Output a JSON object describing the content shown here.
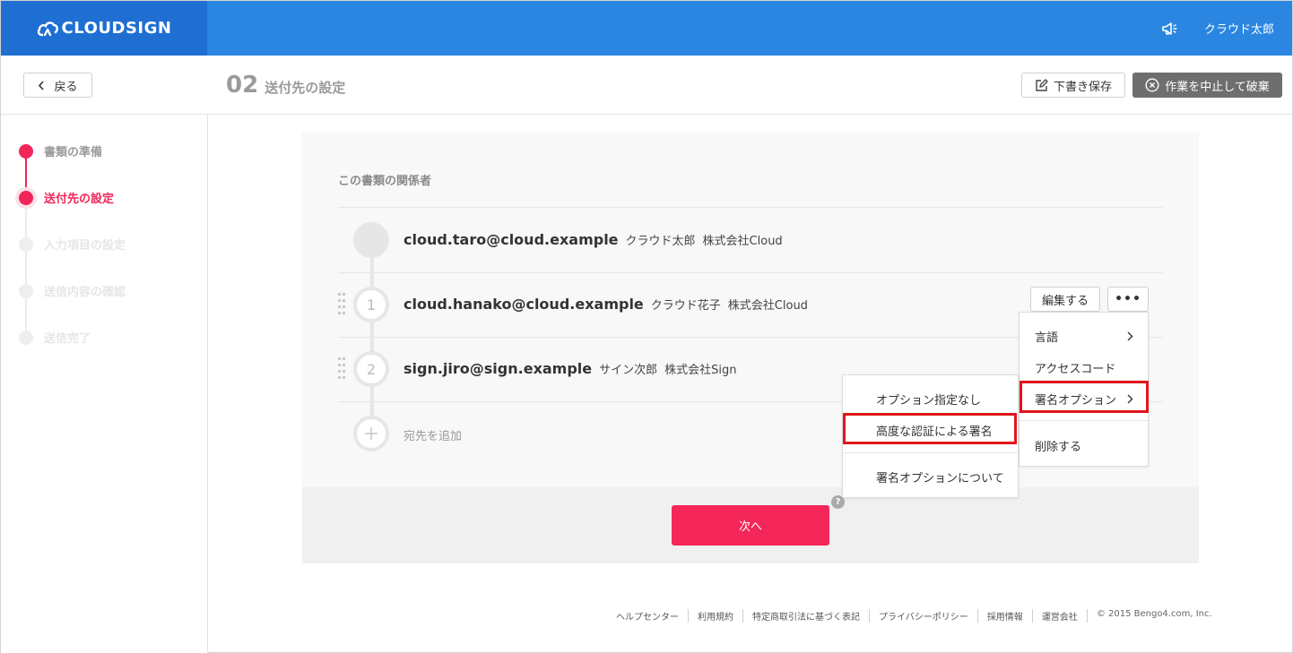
{
  "header": {
    "brand": "CLOUDSIGN",
    "user_name": "クラウド太郎"
  },
  "subheader": {
    "back_label": "戻る",
    "step_number": "02",
    "step_title": "送付先の設定",
    "draft_label": "下書き保存",
    "discard_label": "作業を中止して破棄"
  },
  "sidebar": {
    "steps": [
      {
        "label": "書類の準備",
        "state": "done"
      },
      {
        "label": "送付先の設定",
        "state": "current"
      },
      {
        "label": "入力項目の設定",
        "state": "todo"
      },
      {
        "label": "送信内容の確認",
        "state": "todo"
      },
      {
        "label": "送信完了",
        "state": "todo"
      }
    ]
  },
  "main": {
    "section_label": "この書類の関係者",
    "recipients": [
      {
        "number": "",
        "email": "cloud.taro@cloud.example",
        "name": "クラウド太郎",
        "company": "株式会社Cloud"
      },
      {
        "number": "1",
        "email": "cloud.hanako@cloud.example",
        "name": "クラウド花子",
        "company": "株式会社Cloud"
      },
      {
        "number": "2",
        "email": "sign.jiro@sign.example",
        "name": "サイン次郎",
        "company": "株式会社Sign"
      }
    ],
    "add_label": "宛先を追加",
    "add_icon": "+",
    "edit_label": "編集する",
    "more_label": "•••",
    "next_label": "次へ",
    "help_label": "?"
  },
  "context_menu": {
    "items": [
      "言語",
      "アクセスコード",
      "署名オプション",
      "削除する"
    ]
  },
  "sign_option_menu": {
    "items": [
      "オプション指定なし",
      "高度な認証による署名",
      "署名オプションについて"
    ]
  },
  "footer": {
    "links": [
      "ヘルプセンター",
      "利用規約",
      "特定商取引法に基づく表記",
      "プライバシーポリシー",
      "採用情報",
      "運営会社"
    ],
    "copyright": "© 2015 Bengo4.com, Inc."
  },
  "colors": {
    "topbar": "#2a86e0",
    "brand_bg": "#1f6fd2",
    "accent": "#f4265a",
    "highlight": "#e0161b"
  }
}
